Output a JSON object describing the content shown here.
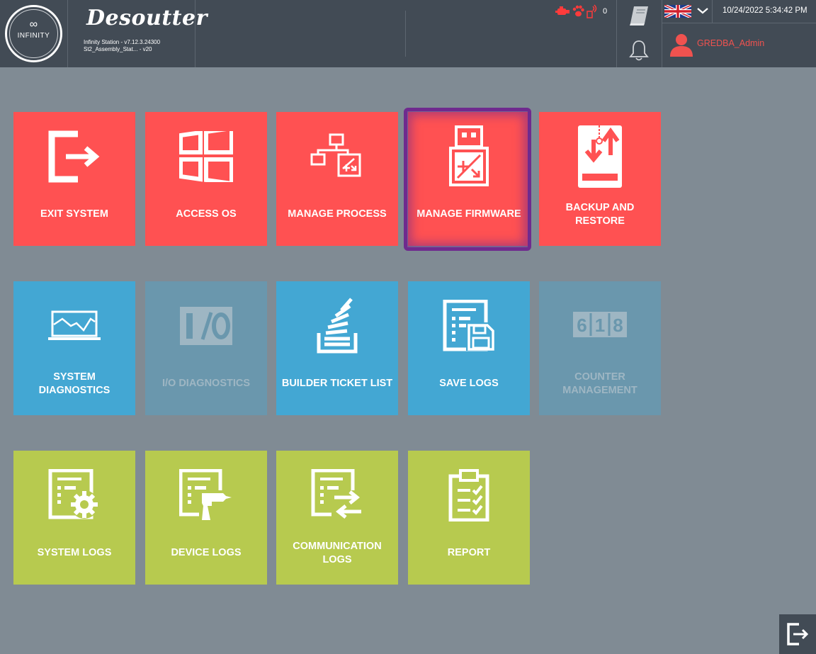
{
  "header": {
    "logo_text": "INFINITY",
    "logo_symbol": "∞",
    "brand": "Desoutter",
    "station_version": "Infinity Station - v7.12.3.24300",
    "station_name": "St2_Assembly_Stat... - v20",
    "status_count": "0",
    "date_time": "10/24/2022 5:34:42 PM",
    "language_flag": "uk-flag",
    "user_name": "GREDBA_Admin",
    "status_color": "#ff3b3b",
    "user_color": "#f0524f"
  },
  "tiles": [
    {
      "label": "EXIT SYSTEM",
      "icon": "exit-icon",
      "color": "red"
    },
    {
      "label": "ACCESS OS",
      "icon": "windows-icon",
      "color": "red"
    },
    {
      "label": "MANAGE PROCESS",
      "icon": "process-icon",
      "color": "red"
    },
    {
      "label": "MANAGE FIRMWARE",
      "icon": "usb-firmware-icon",
      "color": "red",
      "selected": true
    },
    {
      "label": "BACKUP AND RESTORE",
      "icon": "backup-restore-icon",
      "color": "red"
    },
    {
      "label": "SYSTEM DIAGNOSTICS",
      "icon": "monitor-chart-icon",
      "color": "blue"
    },
    {
      "label": "I/O DIAGNOSTICS",
      "icon": "io-icon",
      "color": "blue",
      "disabled": true
    },
    {
      "label": "BUILDER TICKET LIST",
      "icon": "ticket-stack-icon",
      "color": "blue"
    },
    {
      "label": "SAVE LOGS",
      "icon": "save-logs-icon",
      "color": "blue"
    },
    {
      "label": "COUNTER MANAGEMENT",
      "icon": "counter-icon",
      "color": "blue",
      "disabled": true
    },
    {
      "label": "SYSTEM LOGS",
      "icon": "system-logs-icon",
      "color": "green"
    },
    {
      "label": "DEVICE LOGS",
      "icon": "device-logs-icon",
      "color": "green"
    },
    {
      "label": "COMMUNICATION LOGS",
      "icon": "communication-logs-icon",
      "color": "green"
    },
    {
      "label": "REPORT",
      "icon": "report-clipboard-icon",
      "color": "green"
    }
  ],
  "colors": {
    "red": "#ff5152",
    "blue": "#43a7d3",
    "blue_disabled": "#6a97ad",
    "green": "#b7ca4f",
    "header": "#424b55",
    "background": "#808b94",
    "selection": "#6f2a8e"
  }
}
